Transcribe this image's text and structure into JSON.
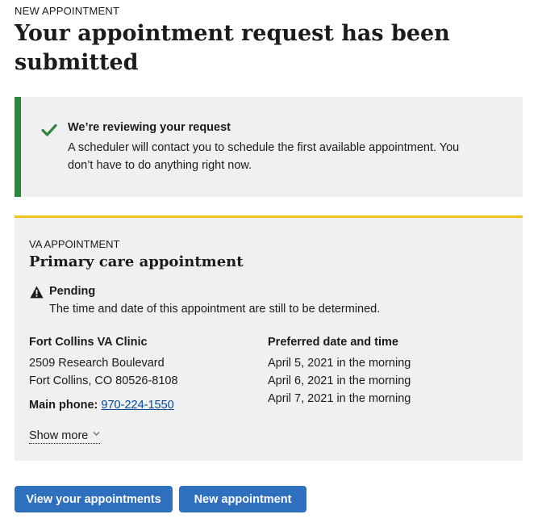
{
  "header": {
    "eyebrow": "NEW APPOINTMENT",
    "title": "Your appointment request has been submitted"
  },
  "alert": {
    "icon": "checkmark-icon",
    "status_color": "#2e8540",
    "heading": "We’re reviewing your request",
    "body": "A scheduler will contact you to schedule the first available appointment. You don’t have to do anything right now."
  },
  "card": {
    "accent_color": "#f0c419",
    "eyebrow": "VA APPOINTMENT",
    "title": "Primary care appointment",
    "status": {
      "icon": "warning-icon",
      "label": "Pending",
      "description": "The time and date of this appointment are still to be determined."
    },
    "facility": {
      "name": "Fort Collins VA Clinic",
      "address_line1": "2509 Research Boulevard",
      "address_line2": "Fort Collins, CO 80526-8108",
      "phone_label": "Main phone:",
      "phone": "970-224-1550"
    },
    "preferred": {
      "heading": "Preferred date and time",
      "times": [
        "April 5, 2021 in the morning",
        "April 6, 2021 in the morning",
        "April 7, 2021 in the morning"
      ]
    },
    "show_more_label": "Show more"
  },
  "actions": {
    "button_color": "#2e6fbe",
    "view_label": "View your appointments",
    "new_label": "New appointment"
  }
}
